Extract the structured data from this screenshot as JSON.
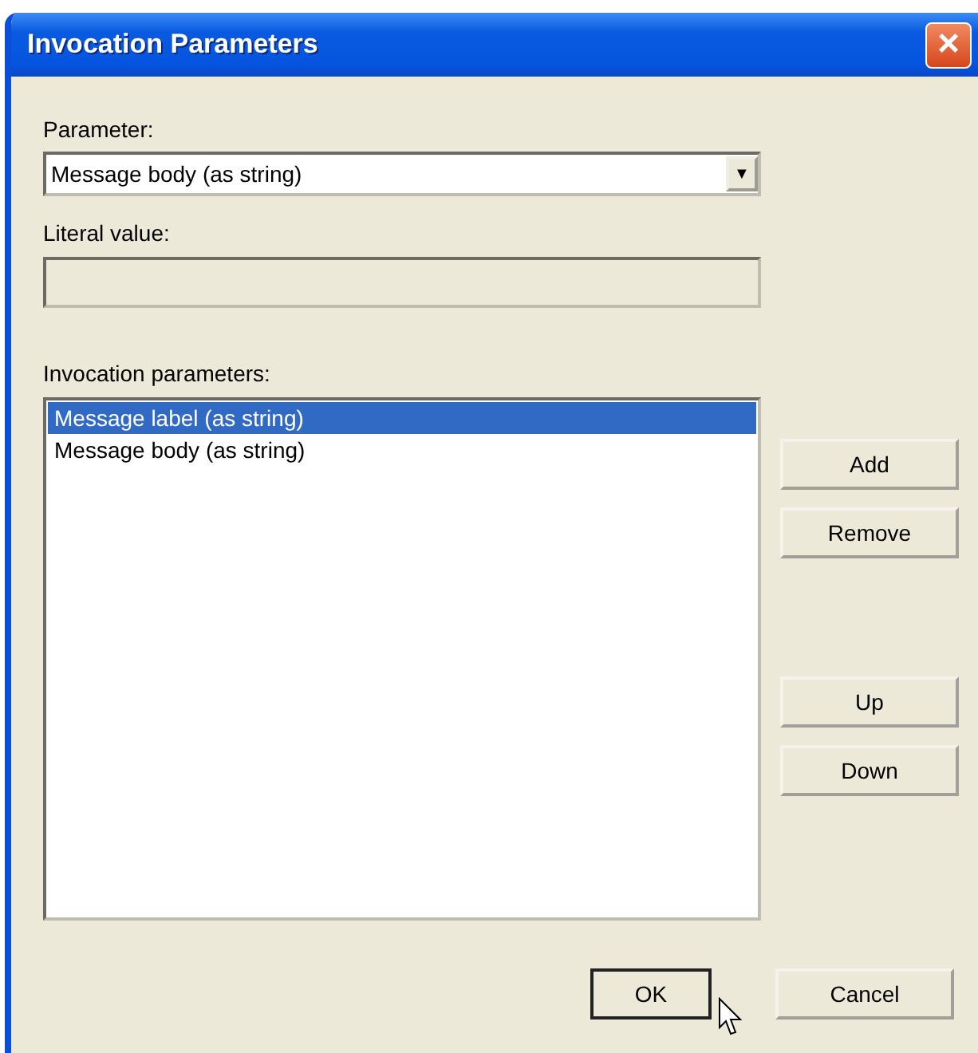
{
  "window": {
    "title": "Invocation Parameters",
    "close": "×"
  },
  "parameter": {
    "label": "Parameter:",
    "value": "Message body (as string)",
    "arrow": "▼"
  },
  "literal_value": {
    "label": "Literal value:",
    "disabled": true
  },
  "invocation_parameters": {
    "label": "Invocation parameters:",
    "items": [
      {
        "text": "Message label (as string)",
        "selected": true
      },
      {
        "text": "Message body (as string)",
        "selected": false
      }
    ]
  },
  "side_button_groups": [
    [
      "Add",
      "Remove"
    ],
    [
      "Up",
      "Down"
    ]
  ],
  "buttons": [
    {
      "label": "OK",
      "default": true
    },
    {
      "label": "Cancel",
      "default": false
    }
  ]
}
